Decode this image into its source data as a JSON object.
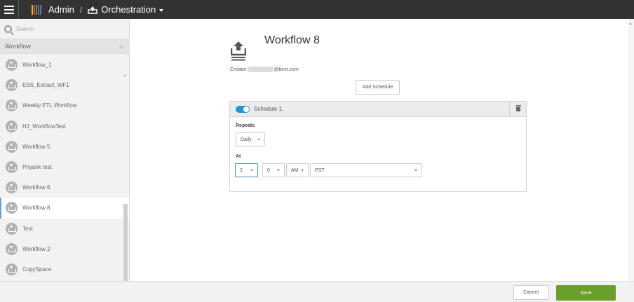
{
  "topbar": {
    "breadcrumb_admin": "Admin",
    "breadcrumb_separator": "/",
    "breadcrumb_section": "Orchestration",
    "logo_colors": [
      "#f2b51d",
      "#e8412c",
      "#3ea343",
      "#2d7cc1",
      "#a356a1"
    ]
  },
  "sidebar": {
    "search_placeholder": "Search",
    "section_title": "Workflow",
    "add_label": "+",
    "items": [
      {
        "label": "Workflow_1",
        "active": false
      },
      {
        "label": "ESS_Extract_WF1",
        "active": false
      },
      {
        "label": "Weekly ETL Workflow",
        "active": false
      },
      {
        "label": "HJ_WorkflowTest",
        "active": false
      },
      {
        "label": "Workflow 5",
        "active": false
      },
      {
        "label": "Priyank test",
        "active": false
      },
      {
        "label": "Workflow 6",
        "active": false
      },
      {
        "label": "Workflow 8",
        "active": true
      },
      {
        "label": "Test",
        "active": false
      },
      {
        "label": "Workflow 2",
        "active": false
      },
      {
        "label": "CopySpace",
        "active": false
      }
    ],
    "active_accent": "#5aa7d8"
  },
  "main": {
    "title": "Workflow 8",
    "creator_label": "Creator:",
    "creator_email_suffix": "@birst.com",
    "add_schedule_label": "Add Schedule",
    "schedule": {
      "title": "Schedule 1.",
      "enabled": true,
      "repeats_label": "Repeats",
      "repeats_value": "Daily",
      "at_label": "At",
      "hour_value": "2",
      "minute_value": "0",
      "ampm_value": "AM",
      "timezone_value": "PST"
    }
  },
  "footer": {
    "cancel_label": "Cancel",
    "save_label": "Save",
    "save_color": "#6a9f2a"
  }
}
